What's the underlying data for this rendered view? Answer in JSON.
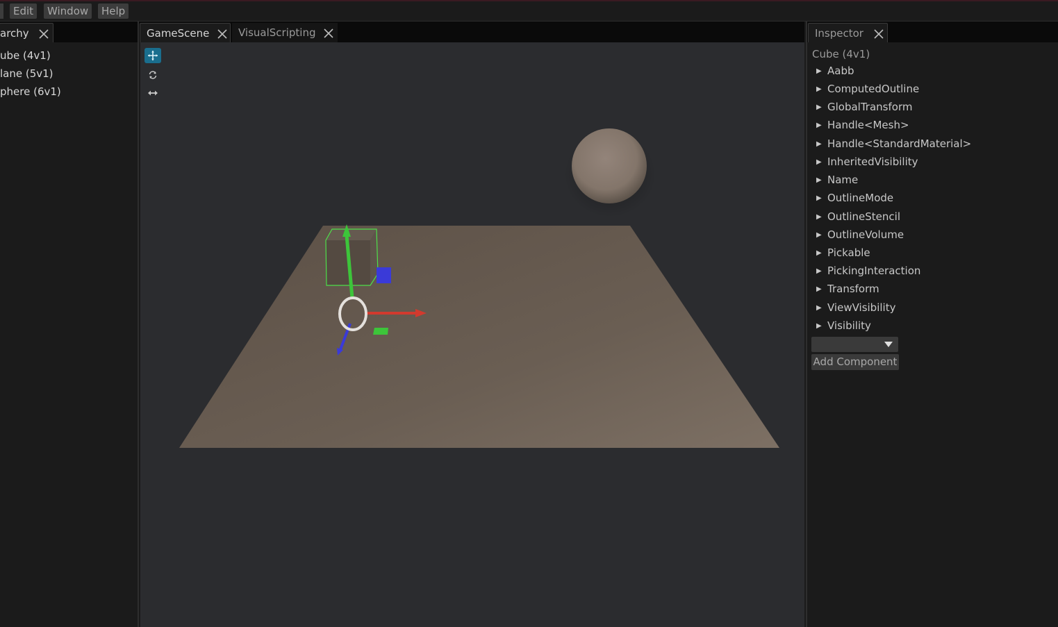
{
  "menubar": {
    "items": [
      {
        "label": "Edit"
      },
      {
        "label": "Window"
      },
      {
        "label": "Help"
      }
    ]
  },
  "hierarchy": {
    "tab_label": "archy",
    "items": [
      {
        "label": "ube (4v1)"
      },
      {
        "label": "lane (5v1)"
      },
      {
        "label": "phere (6v1)"
      }
    ]
  },
  "center": {
    "tabs": [
      {
        "label": "GameScene",
        "active": true
      },
      {
        "label": "VisualScripting",
        "active": false
      }
    ],
    "tools": [
      {
        "name": "translate",
        "active": true
      },
      {
        "name": "rotate",
        "active": false
      },
      {
        "name": "scale",
        "active": false
      }
    ],
    "scene": {
      "objects": [
        "Cube",
        "Plane",
        "Sphere"
      ],
      "selected": "Cube",
      "colors": {
        "background": "#2b2c2f",
        "plane": "#6b5f54",
        "sphere": "#8a7b6d",
        "gizmo_x": "#d23a2e",
        "gizmo_y": "#3dc53a",
        "gizmo_z": "#3a3ad8",
        "selection_outline": "#4ee04a",
        "tool_active": "#1a6e8e"
      }
    }
  },
  "inspector": {
    "tab_label": "Inspector",
    "entity_title": "Cube (4v1)",
    "components": [
      {
        "label": "Aabb"
      },
      {
        "label": "ComputedOutline"
      },
      {
        "label": "GlobalTransform"
      },
      {
        "label": "Handle<Mesh>"
      },
      {
        "label": "Handle<StandardMaterial>"
      },
      {
        "label": "InheritedVisibility"
      },
      {
        "label": "Name"
      },
      {
        "label": "OutlineMode"
      },
      {
        "label": "OutlineStencil"
      },
      {
        "label": "OutlineVolume"
      },
      {
        "label": "Pickable"
      },
      {
        "label": "PickingInteraction"
      },
      {
        "label": "Transform"
      },
      {
        "label": "ViewVisibility"
      },
      {
        "label": "Visibility"
      }
    ],
    "component_select_value": "",
    "add_component_label": "Add Component"
  }
}
